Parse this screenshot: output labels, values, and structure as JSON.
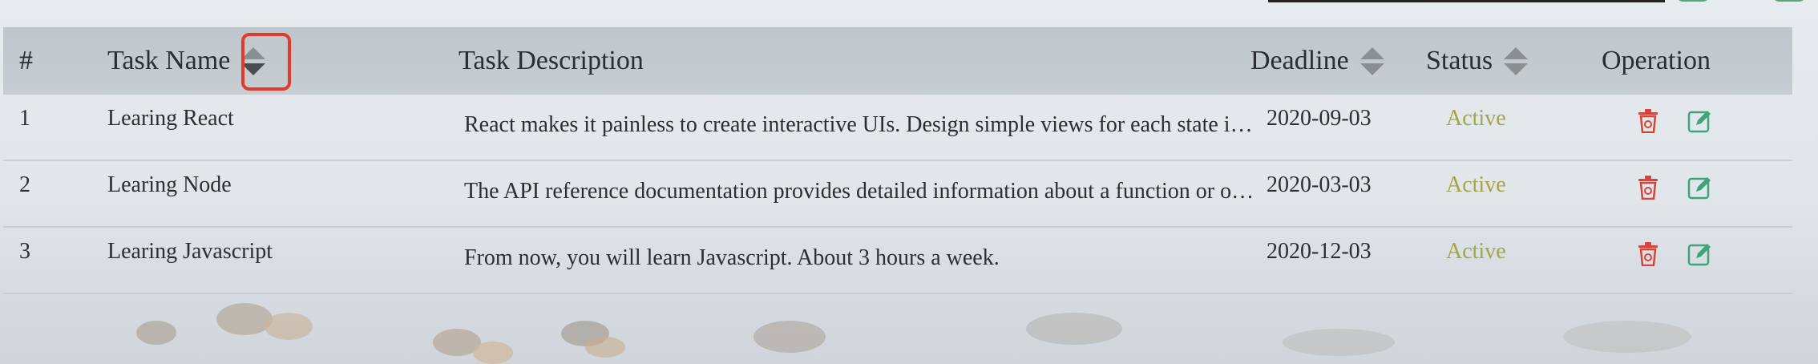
{
  "table": {
    "headers": {
      "index": "#",
      "task_name": "Task Name",
      "task_description": "Task Description",
      "deadline": "Deadline",
      "status": "Status",
      "operation": "Operation"
    },
    "rows": [
      {
        "index": "1",
        "name": "Learing React",
        "description": "React makes it painless to create interactive UIs. Design simple views for each state in your application",
        "deadline": "2020-09-03",
        "status": "Active"
      },
      {
        "index": "2",
        "name": "Learing Node",
        "description": "The API reference documentation provides detailed information about a function or object in Node.js",
        "deadline": "2020-03-03",
        "status": "Active"
      },
      {
        "index": "3",
        "name": "Learing Javascript",
        "description": "From now, you will learn Javascript. About 3 hours a week.",
        "deadline": "2020-12-03",
        "status": "Active"
      }
    ]
  },
  "icons": {
    "sort": "sort-icon",
    "delete": "trash-icon",
    "edit": "edit-icon"
  },
  "colors": {
    "status_active": "#a5a544",
    "delete_icon": "#d9443a",
    "edit_icon": "#3fa47a",
    "highlight": "#e23b2e"
  }
}
